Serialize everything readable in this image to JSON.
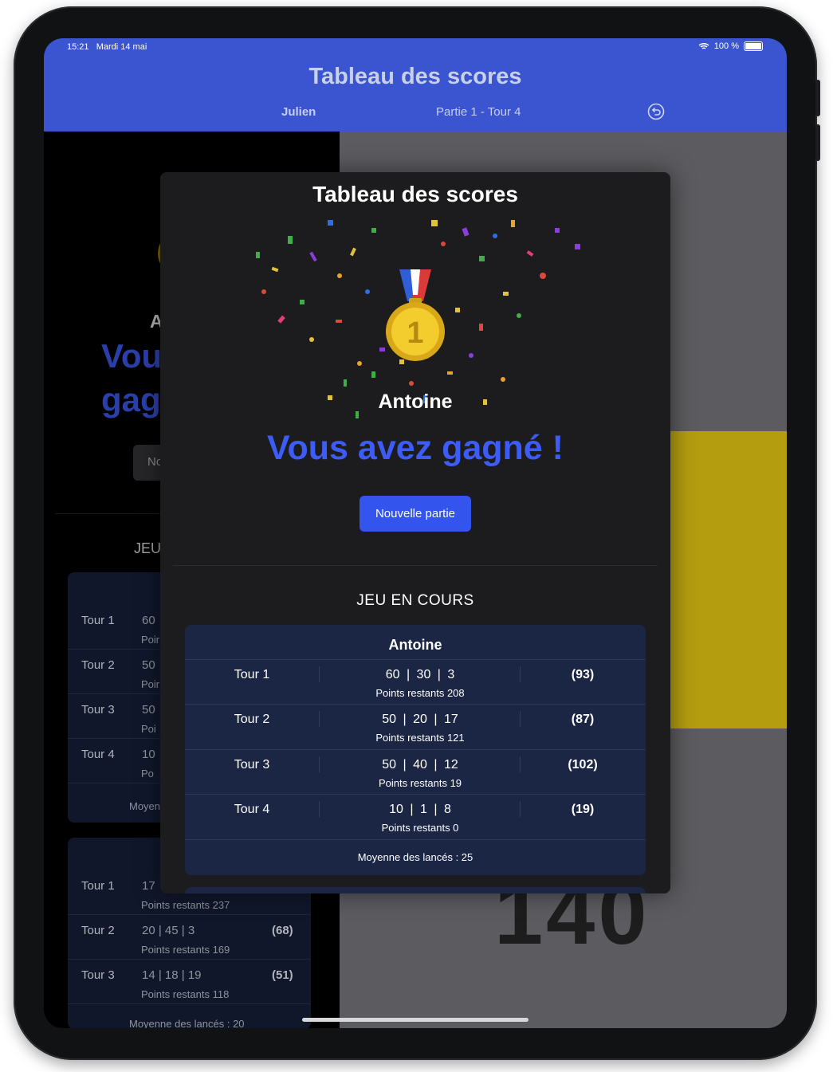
{
  "status_bar": {
    "time": "15:21",
    "date": "Mardi 14 mai",
    "battery": "100 %"
  },
  "header": {
    "title": "Tableau des scores",
    "player": "Julien",
    "game_info": "Partie 1  - Tour 4"
  },
  "background": {
    "big_number": "140",
    "winner_initial": "A",
    "won_text_1": "Vou",
    "won_text_2": "gag",
    "button_fragment": "No",
    "section_fragment": "JEU",
    "card1_rows": [
      {
        "tour": "Tour 1",
        "darts": "60",
        "rem": "Poir"
      },
      {
        "tour": "Tour 2",
        "darts": "50",
        "rem": "Poir"
      },
      {
        "tour": "Tour 3",
        "darts": "50",
        "rem": "Poi"
      },
      {
        "tour": "Tour 4",
        "darts": "10",
        "rem": "Po"
      }
    ],
    "card1_avg": "Moyen",
    "card2_rows": [
      {
        "tour": "Tour 1",
        "darts": "17",
        "rem": "Points restants 237",
        "total": ""
      },
      {
        "tour": "Tour 2",
        "darts": "20   |   45   |   3",
        "rem": "Points restants 169",
        "total": "(68)"
      },
      {
        "tour": "Tour 3",
        "darts": "14   |   18   |   19",
        "rem": "Points restants 118",
        "total": "(51)"
      }
    ],
    "card2_avg": "Moyenne des lancés : 20"
  },
  "modal": {
    "title": "Tableau des scores",
    "winner": "Antoine",
    "won_text": "Vous avez gagné !",
    "new_game_label": "Nouvelle partie",
    "section_title": "JEU EN COURS",
    "card": {
      "player": "Antoine",
      "rows": [
        {
          "tour": "Tour 1",
          "darts": "60  |  30  |  3",
          "total": "(93)",
          "rem": "Points restants 208"
        },
        {
          "tour": "Tour 2",
          "darts": "50  |  20  |  17",
          "total": "(87)",
          "rem": "Points restants 121"
        },
        {
          "tour": "Tour 3",
          "darts": "50  |  40  |  12",
          "total": "(102)",
          "rem": "Points restants 19"
        },
        {
          "tour": "Tour 4",
          "darts": "10  |  1  |  8",
          "total": "(19)",
          "rem": "Points restants 0"
        }
      ],
      "average": "Moyenne des lancés : 25"
    }
  },
  "colors": {
    "header": "#3a55cf",
    "accent": "#3d5cf5",
    "card": "#1b2645",
    "modal": "#1c1c1e",
    "yellow": "#b59d10"
  },
  "icons": {
    "undo": "undo-icon",
    "medal": "gold-medal-icon",
    "wifi": "wifi-icon",
    "battery": "battery-icon"
  }
}
